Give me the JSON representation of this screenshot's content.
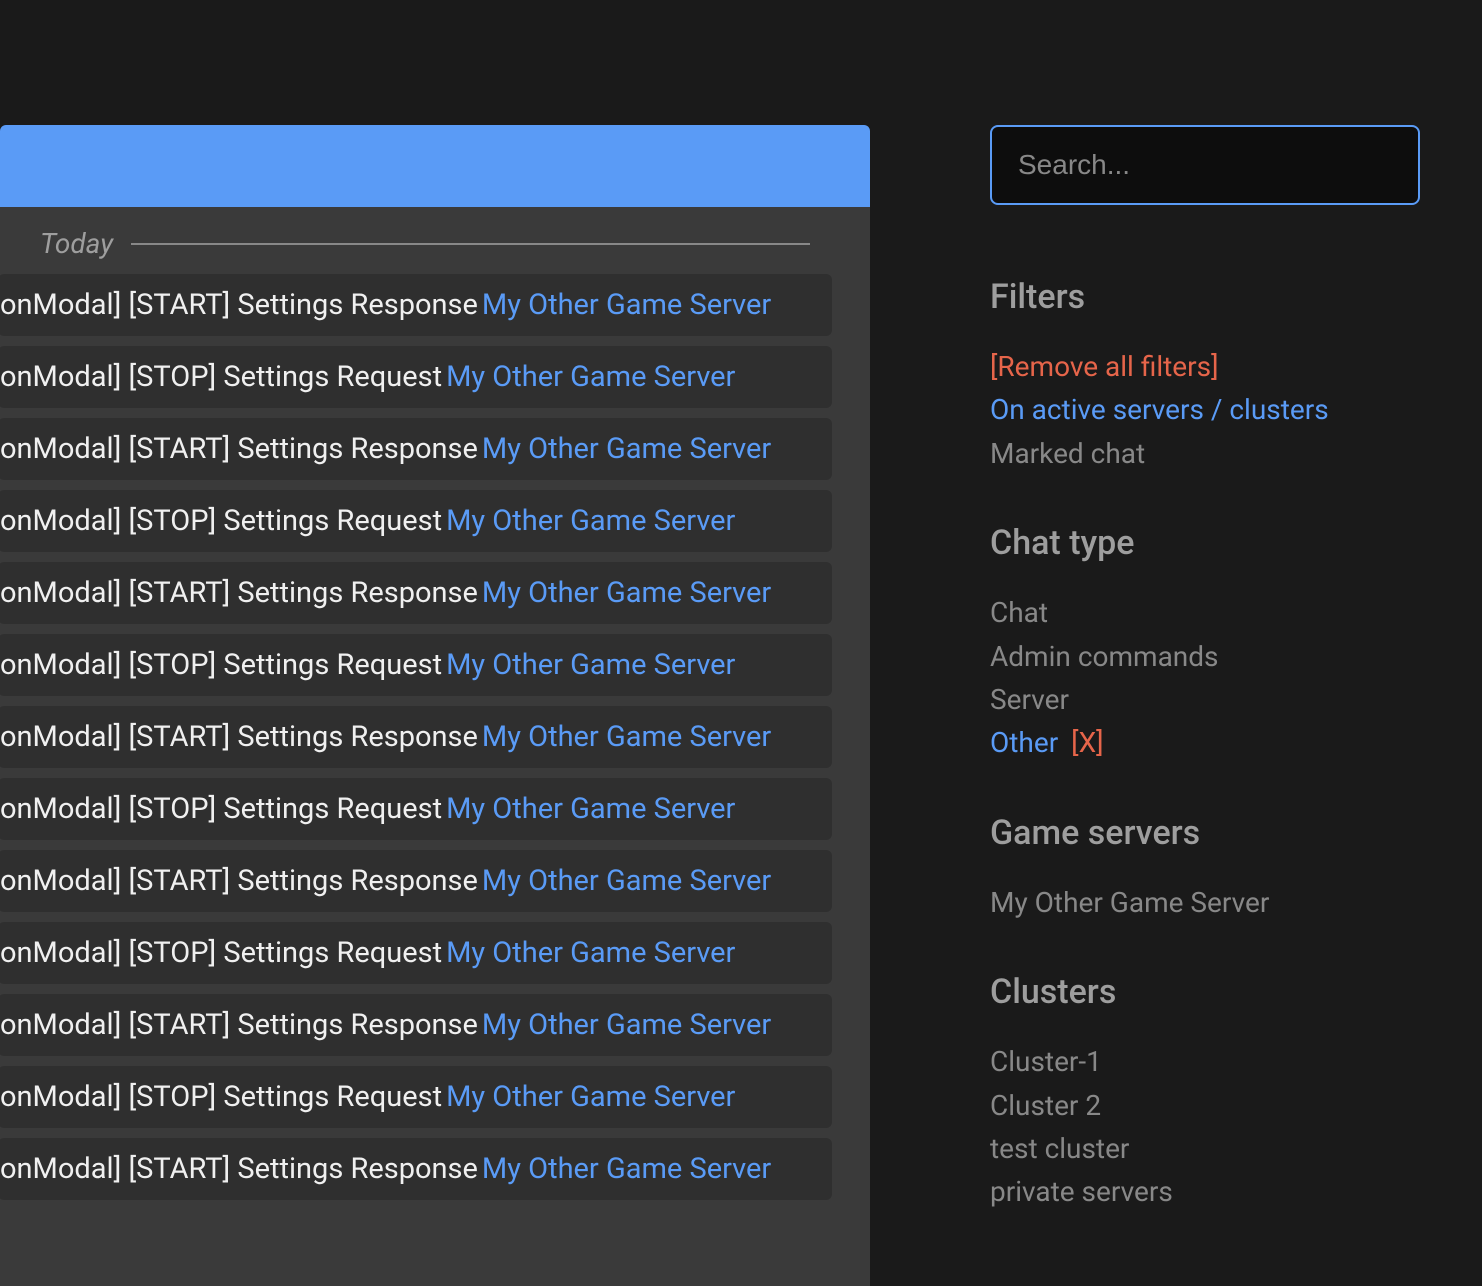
{
  "search": {
    "placeholder": "Search..."
  },
  "date_separator": "Today",
  "log_server_label": "My Other Game Server",
  "log_rows": [
    "onModal] [START] Settings Response",
    "onModal] [STOP] Settings Request",
    "onModal] [START] Settings Response",
    "onModal] [STOP] Settings Request",
    "onModal] [START] Settings Response",
    "onModal] [STOP] Settings Request",
    "onModal] [START] Settings Response",
    "onModal] [STOP] Settings Request",
    "onModal] [START] Settings Response",
    "onModal] [STOP] Settings Request",
    "onModal] [START] Settings Response",
    "onModal] [STOP] Settings Request",
    "onModal] [START] Settings Response"
  ],
  "sidebar": {
    "filters_title": "Filters",
    "remove_all": "[Remove all filters]",
    "active_servers": "On active servers / clusters",
    "marked_chat": "Marked chat",
    "chat_type_title": "Chat type",
    "chat_types": {
      "chat": "Chat",
      "admin": "Admin commands",
      "server": "Server",
      "other": "Other",
      "other_x": "[X]"
    },
    "game_servers_title": "Game servers",
    "game_servers": [
      "My Other Game Server"
    ],
    "clusters_title": "Clusters",
    "clusters": [
      "Cluster-1",
      "Cluster 2",
      "test cluster",
      "private servers"
    ]
  }
}
